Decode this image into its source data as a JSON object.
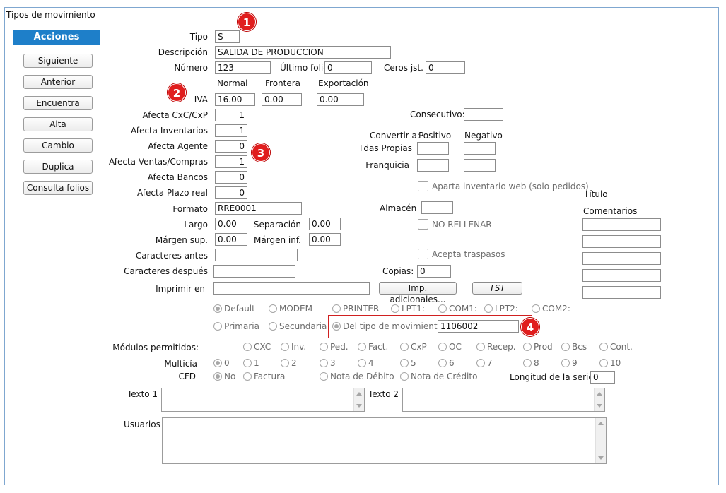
{
  "window": {
    "title": "Tipos de movimiento"
  },
  "sidebar": {
    "header": "Acciones",
    "buttons": [
      "Siguiente",
      "Anterior",
      "Encuentra",
      "Alta",
      "Cambio",
      "Duplica",
      "Consulta folios"
    ]
  },
  "badges": [
    "1",
    "2",
    "3",
    "4"
  ],
  "form": {
    "tipo": {
      "label": "Tipo",
      "value": "S"
    },
    "descripcion": {
      "label": "Descripción",
      "value": "SALIDA DE PRODUCCION"
    },
    "numero": {
      "label": "Número",
      "value": "123"
    },
    "ultimo_folio": {
      "label": "Último folio",
      "value": "0"
    },
    "ceros": {
      "label": "Ceros jst.",
      "value": "0"
    },
    "iva": {
      "label": "IVA",
      "col_normal": "Normal",
      "col_frontera": "Frontera",
      "col_exportacion": "Exportación",
      "normal": "16.00",
      "frontera": "0.00",
      "exportacion": "0.00"
    },
    "afecta": {
      "cxc": {
        "label": "Afecta  CxC/CxP",
        "value": "1"
      },
      "inventarios": {
        "label": "Afecta  Inventarios",
        "value": "1"
      },
      "agente": {
        "label": "Afecta  Agente",
        "value": "0"
      },
      "ventas": {
        "label": "Afecta  Ventas/Compras",
        "value": "1"
      },
      "bancos": {
        "label": "Afecta  Bancos",
        "value": "0"
      },
      "plazo": {
        "label": "Afecta  Plazo real",
        "value": "0"
      }
    },
    "formato": {
      "label": "Formato",
      "value": "RRE0001"
    },
    "largo": {
      "label": "Largo",
      "value": "0.00"
    },
    "separacion": {
      "label": "Separación",
      "value": "0.00"
    },
    "margen_sup": {
      "label": "Márgen sup.",
      "value": "0.00"
    },
    "margen_inf": {
      "label": "Márgen inf.",
      "value": "0.00"
    },
    "caracteres_antes": {
      "label": "Caracteres antes",
      "value": ""
    },
    "caracteres_despues": {
      "label": "Caracteres después",
      "value": ""
    },
    "imprimir_en": {
      "label": "Imprimir en",
      "value": ""
    },
    "imp_adicionales": "Imp. adicionales...",
    "tst": "TST",
    "copias": {
      "label": "Copias:",
      "value": "0"
    },
    "consecutivo": {
      "label": "Consecutivo:",
      "value": ""
    },
    "convertir": {
      "label": "Convertir a:",
      "positivo": "Positivo",
      "negativo": "Negativo"
    },
    "tdas_propias": "Tdas Propias",
    "franquicia": "Franquicia",
    "aparta": "Aparta inventario web (solo pedidos)",
    "almacen": {
      "label": "Almacén",
      "value": ""
    },
    "no_rellenar": "NO RELLENAR",
    "acepta_traspasos": "Acepta traspasos",
    "titulo": "Título",
    "comentarios": "Comentarios",
    "printer_opts": [
      "Default",
      "MODEM",
      "PRINTER",
      "LPT1:",
      "COM1:",
      "LPT2:",
      "COM2:"
    ],
    "serie_opts": [
      "Primaria",
      "Secundaria",
      "Del tipo de movimiento"
    ],
    "del_tipo_value": "1106002",
    "modulos": {
      "label": "Módulos permitidos:",
      "opts": [
        "CXC",
        "Inv.",
        "Ped.",
        "Fact.",
        "CxP",
        "OC",
        "Recep.",
        "Prod",
        "Bcs",
        "Cont."
      ]
    },
    "multicia": {
      "label": "Multicía",
      "opts": [
        "0",
        "1",
        "2",
        "3",
        "4",
        "5",
        "6",
        "7",
        "8",
        "9",
        "10"
      ]
    },
    "cfd": {
      "label": "CFD",
      "opts": [
        "No",
        "Factura",
        "Nota de Débito",
        "Nota de Crédito"
      ]
    },
    "longitud_serie": {
      "label": "Longitud de la serie",
      "value": "0"
    },
    "texto1": "Texto 1",
    "texto2": "Texto 2",
    "usuarios": "Usuarios"
  }
}
